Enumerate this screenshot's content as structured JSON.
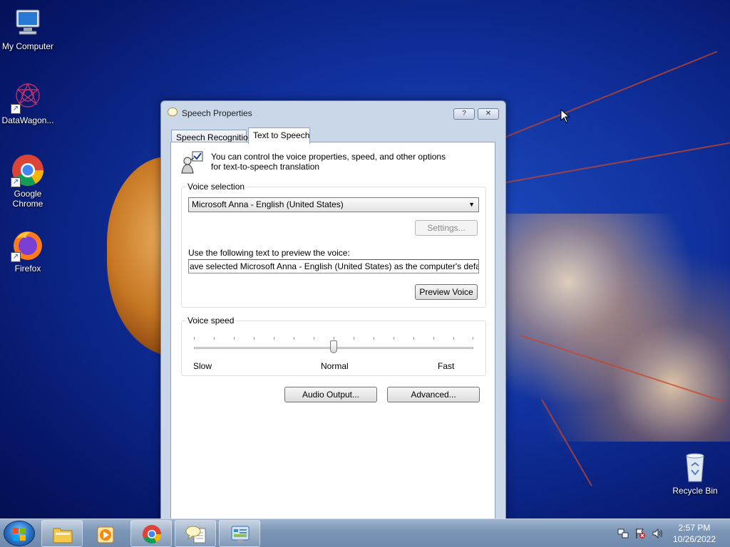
{
  "desktop": {
    "icons": [
      {
        "label": "My Computer",
        "icon": "computer-icon"
      },
      {
        "label": "DataWagon...",
        "icon": "datawagon-icon"
      },
      {
        "label": "Google Chrome",
        "icon": "chrome-icon"
      },
      {
        "label": "Firefox",
        "icon": "firefox-icon"
      },
      {
        "label": "Recycle Bin",
        "icon": "recycle-bin-icon"
      }
    ]
  },
  "dialog": {
    "title": "Speech Properties",
    "help_button": "?",
    "close_button": "✕",
    "tabs": [
      {
        "label": "Speech Recognition",
        "active": false
      },
      {
        "label": "Text to Speech",
        "active": true
      }
    ],
    "intro_text": "You can control the voice properties, speed, and other options for text-to-speech translation",
    "voice_selection": {
      "group_label": "Voice selection",
      "selected_voice": "Microsoft Anna - English (United States)",
      "settings_button": "Settings...",
      "preview_label": "Use the following text to preview the voice:",
      "preview_text": "ave selected Microsoft Anna - English (United States) as the computer's default voice.",
      "preview_button": "Preview Voice"
    },
    "voice_speed": {
      "group_label": "Voice speed",
      "slow_label": "Slow",
      "normal_label": "Normal",
      "fast_label": "Fast",
      "level": 0.5
    },
    "audio_output_button": "Audio Output...",
    "advanced_button": "Advanced..."
  },
  "taskbar": {
    "items": [
      "file-explorer-icon",
      "media-player-icon",
      "chrome-icon",
      "speech-bubble-icon",
      "control-panel-icon"
    ],
    "clock_time": "2:57 PM",
    "clock_date": "10/26/2022"
  },
  "colors": {
    "desktop_blue": "#0f2f9a",
    "taskbar": "#7d97b8",
    "dialog_frame": "#c9d7e8"
  }
}
